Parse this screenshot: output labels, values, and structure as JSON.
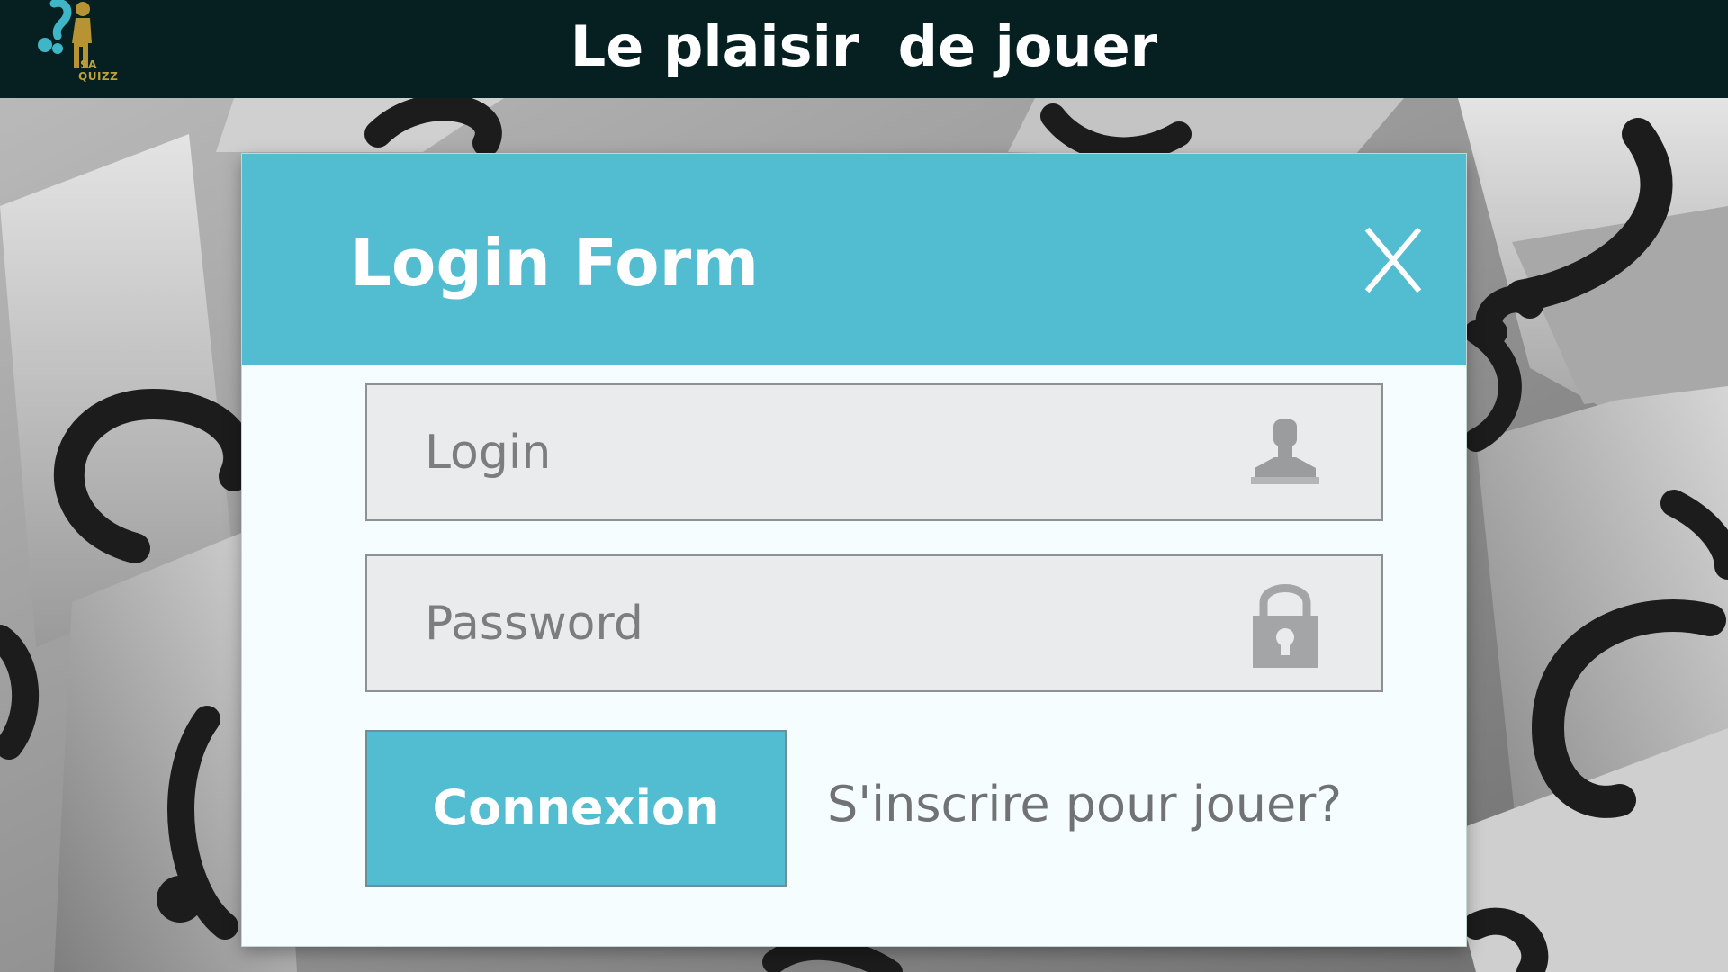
{
  "header": {
    "title": "Le plaisir  de jouer",
    "logo": {
      "text_line1": "SA",
      "text_line2": "QUIZZ",
      "icon": "quiz-figure-logo"
    }
  },
  "dialog": {
    "title": "Login Form",
    "close_label": "X",
    "login_field": {
      "placeholder": "Login",
      "value": "",
      "icon": "user-icon"
    },
    "password_field": {
      "placeholder": "Password",
      "value": "",
      "icon": "lock-icon"
    },
    "submit_label": "Connexion",
    "signup_link": "S'inscrire pour jouer?"
  },
  "colors": {
    "header_bg": "#062022",
    "accent": "#52bdd1",
    "dialog_bg": "#f6fdfe",
    "field_bg": "#e9ebec",
    "muted_text": "#707274"
  }
}
